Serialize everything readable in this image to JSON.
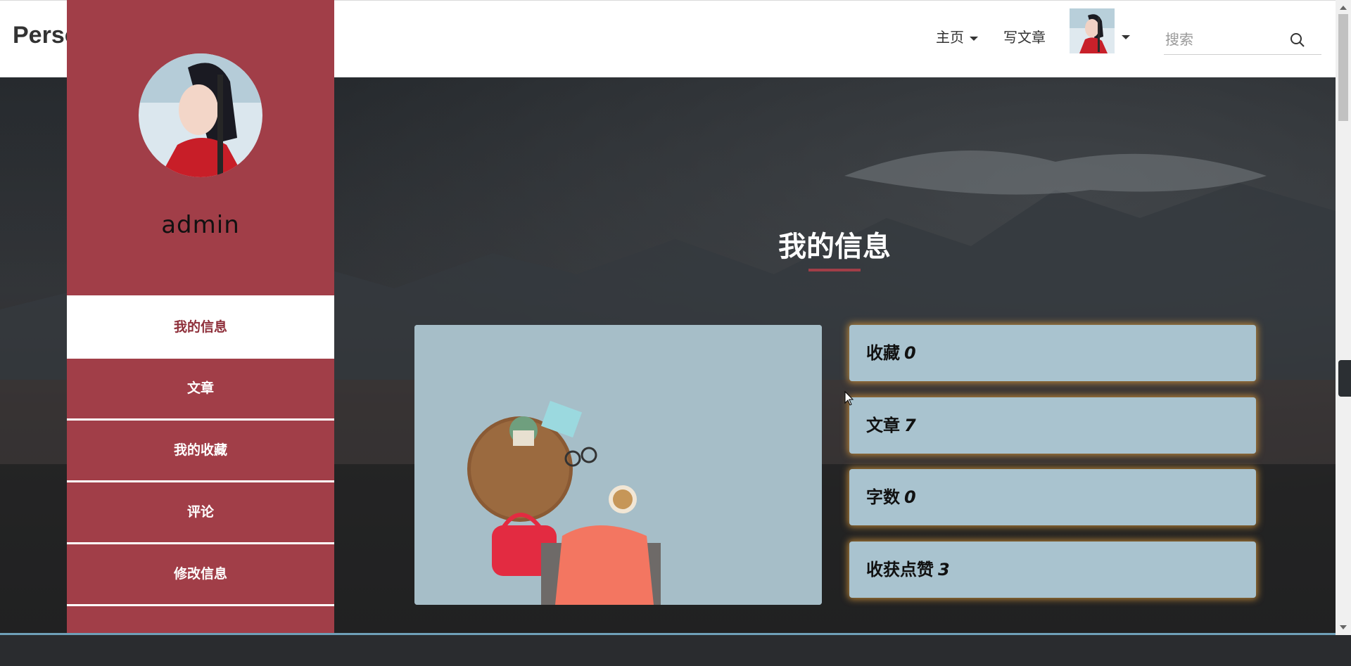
{
  "navbar": {
    "brand": "Perso",
    "home_label": "主页",
    "write_label": "写文章",
    "search_placeholder": "搜索",
    "avatar_icon": "user-avatar"
  },
  "sidebar": {
    "username": "admin",
    "menu": [
      {
        "label": "我的信息",
        "active": true
      },
      {
        "label": "文章"
      },
      {
        "label": "我的收藏"
      },
      {
        "label": "评论"
      },
      {
        "label": "修改信息"
      },
      {
        "label": ""
      }
    ]
  },
  "main": {
    "title": "我的信息",
    "stats": [
      {
        "label": "收藏",
        "value": "0"
      },
      {
        "label": "文章",
        "value": "7"
      },
      {
        "label": "字数",
        "value": "0"
      },
      {
        "label": "收获点赞",
        "value": "3"
      }
    ]
  },
  "colors": {
    "sidebar": "#a13e48",
    "stat_card": "#a9c3cf",
    "card_glow": "#e6a03c"
  }
}
